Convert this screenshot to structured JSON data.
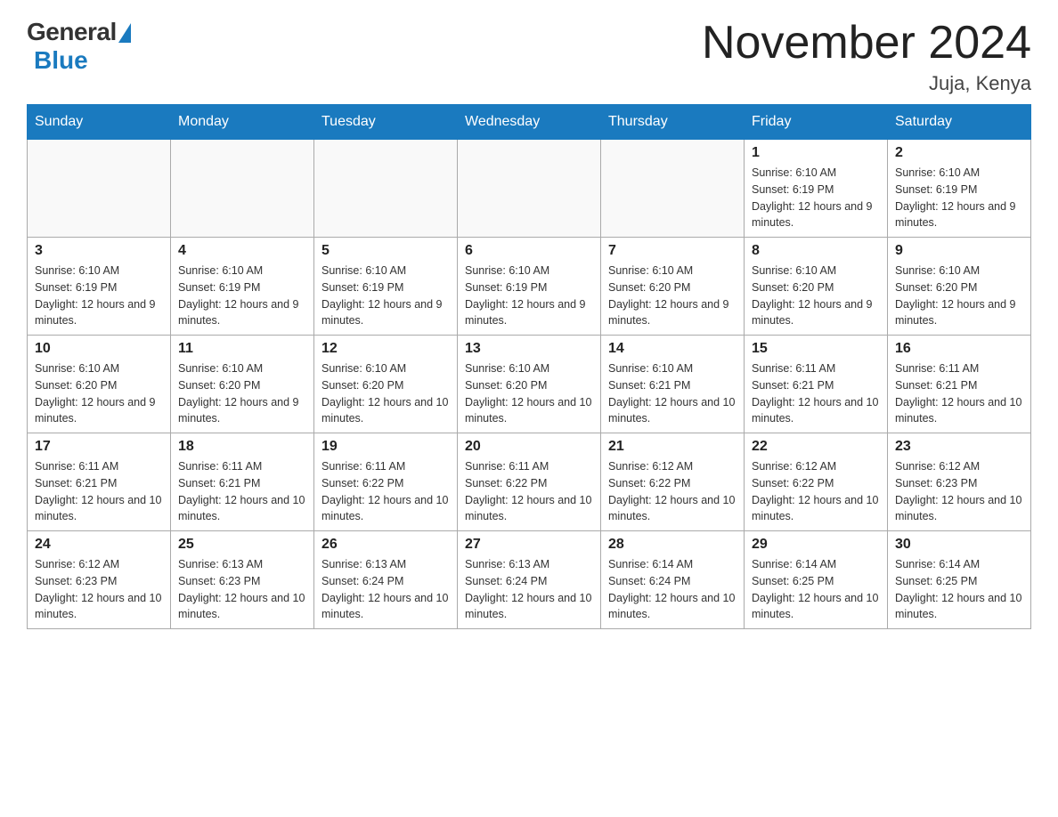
{
  "header": {
    "logo_general": "General",
    "logo_blue": "Blue",
    "month_title": "November 2024",
    "location": "Juja, Kenya"
  },
  "days_of_week": [
    "Sunday",
    "Monday",
    "Tuesday",
    "Wednesday",
    "Thursday",
    "Friday",
    "Saturday"
  ],
  "weeks": [
    [
      {
        "day": "",
        "info": ""
      },
      {
        "day": "",
        "info": ""
      },
      {
        "day": "",
        "info": ""
      },
      {
        "day": "",
        "info": ""
      },
      {
        "day": "",
        "info": ""
      },
      {
        "day": "1",
        "info": "Sunrise: 6:10 AM\nSunset: 6:19 PM\nDaylight: 12 hours and 9 minutes."
      },
      {
        "day": "2",
        "info": "Sunrise: 6:10 AM\nSunset: 6:19 PM\nDaylight: 12 hours and 9 minutes."
      }
    ],
    [
      {
        "day": "3",
        "info": "Sunrise: 6:10 AM\nSunset: 6:19 PM\nDaylight: 12 hours and 9 minutes."
      },
      {
        "day": "4",
        "info": "Sunrise: 6:10 AM\nSunset: 6:19 PM\nDaylight: 12 hours and 9 minutes."
      },
      {
        "day": "5",
        "info": "Sunrise: 6:10 AM\nSunset: 6:19 PM\nDaylight: 12 hours and 9 minutes."
      },
      {
        "day": "6",
        "info": "Sunrise: 6:10 AM\nSunset: 6:19 PM\nDaylight: 12 hours and 9 minutes."
      },
      {
        "day": "7",
        "info": "Sunrise: 6:10 AM\nSunset: 6:20 PM\nDaylight: 12 hours and 9 minutes."
      },
      {
        "day": "8",
        "info": "Sunrise: 6:10 AM\nSunset: 6:20 PM\nDaylight: 12 hours and 9 minutes."
      },
      {
        "day": "9",
        "info": "Sunrise: 6:10 AM\nSunset: 6:20 PM\nDaylight: 12 hours and 9 minutes."
      }
    ],
    [
      {
        "day": "10",
        "info": "Sunrise: 6:10 AM\nSunset: 6:20 PM\nDaylight: 12 hours and 9 minutes."
      },
      {
        "day": "11",
        "info": "Sunrise: 6:10 AM\nSunset: 6:20 PM\nDaylight: 12 hours and 9 minutes."
      },
      {
        "day": "12",
        "info": "Sunrise: 6:10 AM\nSunset: 6:20 PM\nDaylight: 12 hours and 10 minutes."
      },
      {
        "day": "13",
        "info": "Sunrise: 6:10 AM\nSunset: 6:20 PM\nDaylight: 12 hours and 10 minutes."
      },
      {
        "day": "14",
        "info": "Sunrise: 6:10 AM\nSunset: 6:21 PM\nDaylight: 12 hours and 10 minutes."
      },
      {
        "day": "15",
        "info": "Sunrise: 6:11 AM\nSunset: 6:21 PM\nDaylight: 12 hours and 10 minutes."
      },
      {
        "day": "16",
        "info": "Sunrise: 6:11 AM\nSunset: 6:21 PM\nDaylight: 12 hours and 10 minutes."
      }
    ],
    [
      {
        "day": "17",
        "info": "Sunrise: 6:11 AM\nSunset: 6:21 PM\nDaylight: 12 hours and 10 minutes."
      },
      {
        "day": "18",
        "info": "Sunrise: 6:11 AM\nSunset: 6:21 PM\nDaylight: 12 hours and 10 minutes."
      },
      {
        "day": "19",
        "info": "Sunrise: 6:11 AM\nSunset: 6:22 PM\nDaylight: 12 hours and 10 minutes."
      },
      {
        "day": "20",
        "info": "Sunrise: 6:11 AM\nSunset: 6:22 PM\nDaylight: 12 hours and 10 minutes."
      },
      {
        "day": "21",
        "info": "Sunrise: 6:12 AM\nSunset: 6:22 PM\nDaylight: 12 hours and 10 minutes."
      },
      {
        "day": "22",
        "info": "Sunrise: 6:12 AM\nSunset: 6:22 PM\nDaylight: 12 hours and 10 minutes."
      },
      {
        "day": "23",
        "info": "Sunrise: 6:12 AM\nSunset: 6:23 PM\nDaylight: 12 hours and 10 minutes."
      }
    ],
    [
      {
        "day": "24",
        "info": "Sunrise: 6:12 AM\nSunset: 6:23 PM\nDaylight: 12 hours and 10 minutes."
      },
      {
        "day": "25",
        "info": "Sunrise: 6:13 AM\nSunset: 6:23 PM\nDaylight: 12 hours and 10 minutes."
      },
      {
        "day": "26",
        "info": "Sunrise: 6:13 AM\nSunset: 6:24 PM\nDaylight: 12 hours and 10 minutes."
      },
      {
        "day": "27",
        "info": "Sunrise: 6:13 AM\nSunset: 6:24 PM\nDaylight: 12 hours and 10 minutes."
      },
      {
        "day": "28",
        "info": "Sunrise: 6:14 AM\nSunset: 6:24 PM\nDaylight: 12 hours and 10 minutes."
      },
      {
        "day": "29",
        "info": "Sunrise: 6:14 AM\nSunset: 6:25 PM\nDaylight: 12 hours and 10 minutes."
      },
      {
        "day": "30",
        "info": "Sunrise: 6:14 AM\nSunset: 6:25 PM\nDaylight: 12 hours and 10 minutes."
      }
    ]
  ]
}
